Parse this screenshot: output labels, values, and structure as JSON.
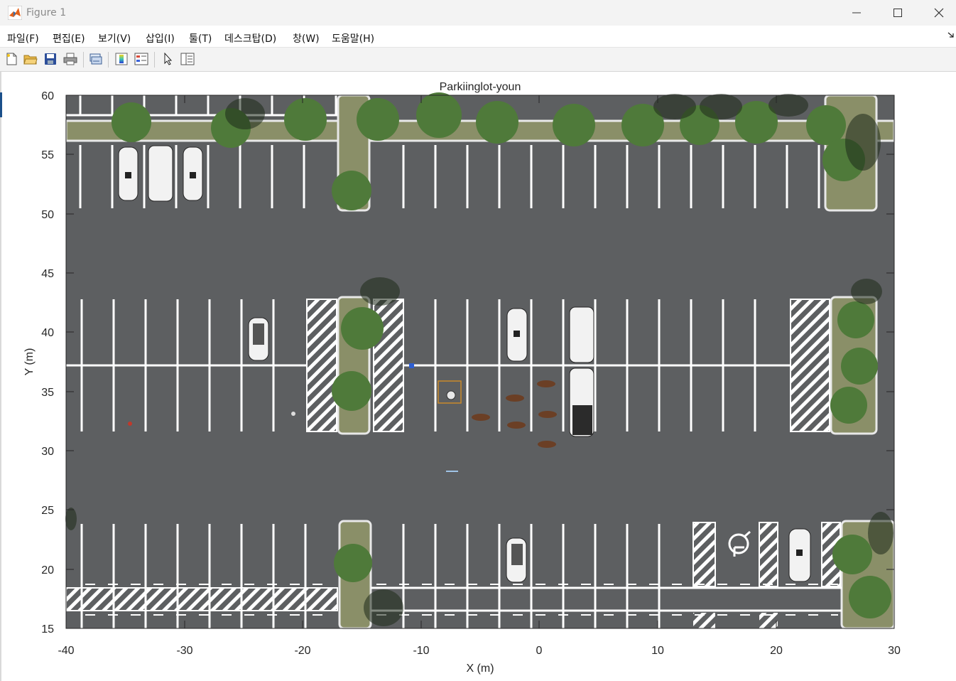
{
  "window": {
    "title": "Figure 1",
    "min_icon": "minimize-icon",
    "max_icon": "maximize-icon",
    "close_icon": "close-icon"
  },
  "menu": {
    "items": [
      "파일(F)",
      "편집(E)",
      "보기(V)",
      "삽입(I)",
      "툴(T)",
      "데스크탑(D)",
      "창(W)",
      "도움말(H)"
    ]
  },
  "toolbar": {
    "buttons": [
      "new-figure-icon",
      "open-file-icon",
      "save-icon",
      "print-icon",
      "link-plot-icon",
      "colorbar-icon",
      "legend-icon",
      "pointer-icon",
      "property-editor-icon"
    ]
  },
  "plot": {
    "title": "Parkiinglot-youn",
    "xlabel": "X (m)",
    "ylabel": "Y (m)",
    "xlim": [
      -40,
      30
    ],
    "ylim": [
      15,
      60
    ],
    "xticks": [
      "-40",
      "-30",
      "-20",
      "-10",
      "0",
      "10",
      "20",
      "30"
    ],
    "yticks": [
      "15",
      "20",
      "25",
      "30",
      "35",
      "40",
      "45",
      "50",
      "55",
      "60"
    ]
  },
  "scene": {
    "asphalt_color": "#5d5f61",
    "grass_color": "#8a8f68",
    "line_color": "#ffffff",
    "tree_color": "#4f7a3a",
    "car_color": "#f2f2f2",
    "animal_color": "#6b3f25",
    "highlight_color": "#c98a2b"
  }
}
